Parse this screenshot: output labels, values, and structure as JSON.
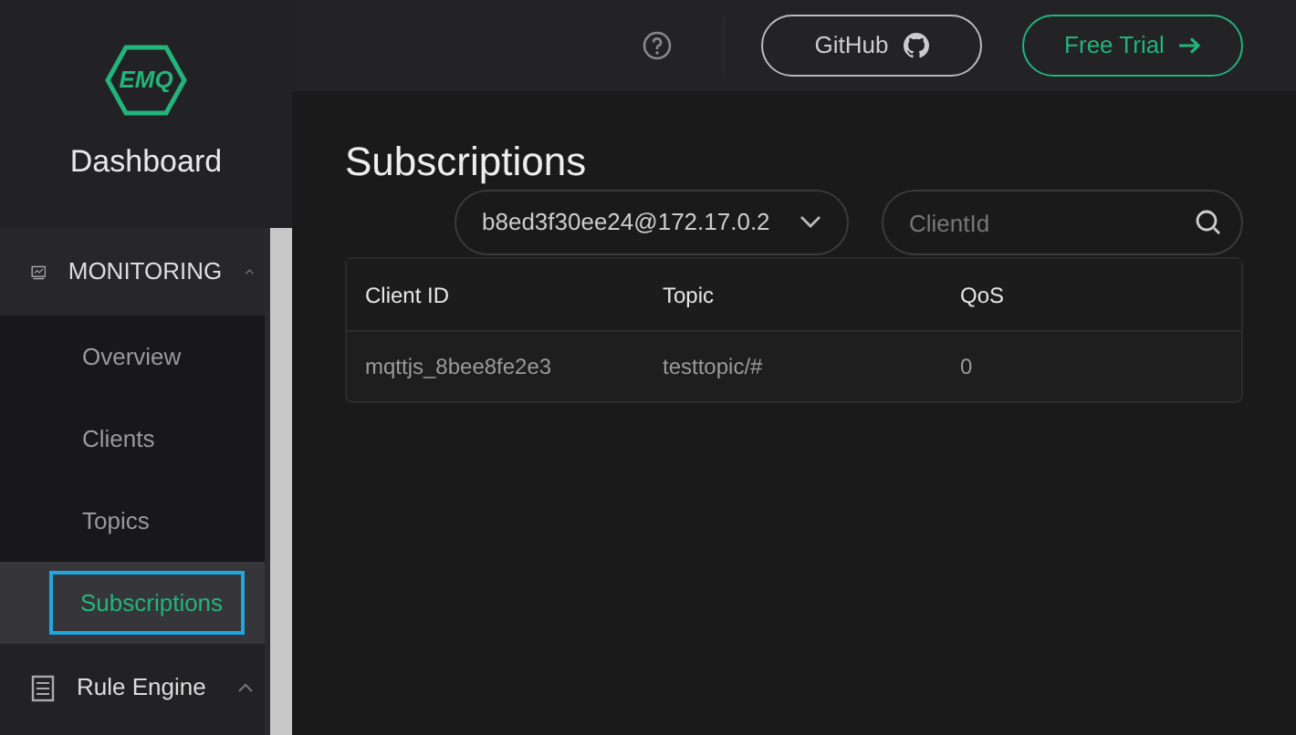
{
  "sidebar": {
    "logo": "EMQ",
    "title": "Dashboard",
    "menu": [
      {
        "label": "MONITORING",
        "kind": "monitor",
        "expanded": true,
        "children": [
          {
            "label": "Overview",
            "selected": false
          },
          {
            "label": "Clients",
            "selected": false
          },
          {
            "label": "Topics",
            "selected": false
          },
          {
            "label": "Subscriptions",
            "selected": true
          }
        ]
      },
      {
        "label": "Rule Engine",
        "kind": "list",
        "expanded": true
      }
    ]
  },
  "header": {
    "buttons": [
      {
        "label": "GitHub",
        "kind": "github"
      },
      {
        "label": "Free Trial",
        "kind": "trial"
      }
    ]
  },
  "page": {
    "title": "Subscriptions",
    "node_select": {
      "value": "b8ed3f30ee24@172.17.0.2"
    },
    "search": {
      "placeholder": "ClientId"
    },
    "table": {
      "columns": [
        "Client ID",
        "Topic",
        "QoS"
      ],
      "rows": [
        [
          "mqttjs_8bee8fe2e3",
          "testtopic/#",
          "0"
        ]
      ]
    }
  }
}
